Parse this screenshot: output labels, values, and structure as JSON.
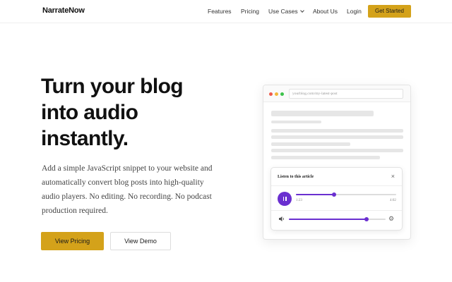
{
  "nav": {
    "logo": "NarrateNow",
    "links": [
      "Features",
      "Pricing",
      "Use Cases",
      "About Us",
      "Login"
    ],
    "cta": "Get Started"
  },
  "hero": {
    "title_lines": [
      "Turn your blog",
      "into audio",
      "instantly."
    ],
    "description": "Add a simple JavaScript snippet to your website and automatically convert blog posts into high-quality audio players. No editing. No recording. No podcast production required.",
    "primary_button": "View Pricing",
    "secondary_button": "View Demo"
  },
  "mock_browser": {
    "url": "yourblog.com/my-latest-post",
    "window_dots": [
      "#ef5b4b",
      "#f3b83a",
      "#3cc24b"
    ]
  },
  "player": {
    "title": "Listen to this article",
    "close_glyph": "×",
    "current_time": "1:23",
    "duration": "4:02",
    "progress": 0.38,
    "volume": 0.8,
    "accent_color": "#6a2fd0"
  },
  "colors": {
    "brand_button": "#d4a21a"
  }
}
